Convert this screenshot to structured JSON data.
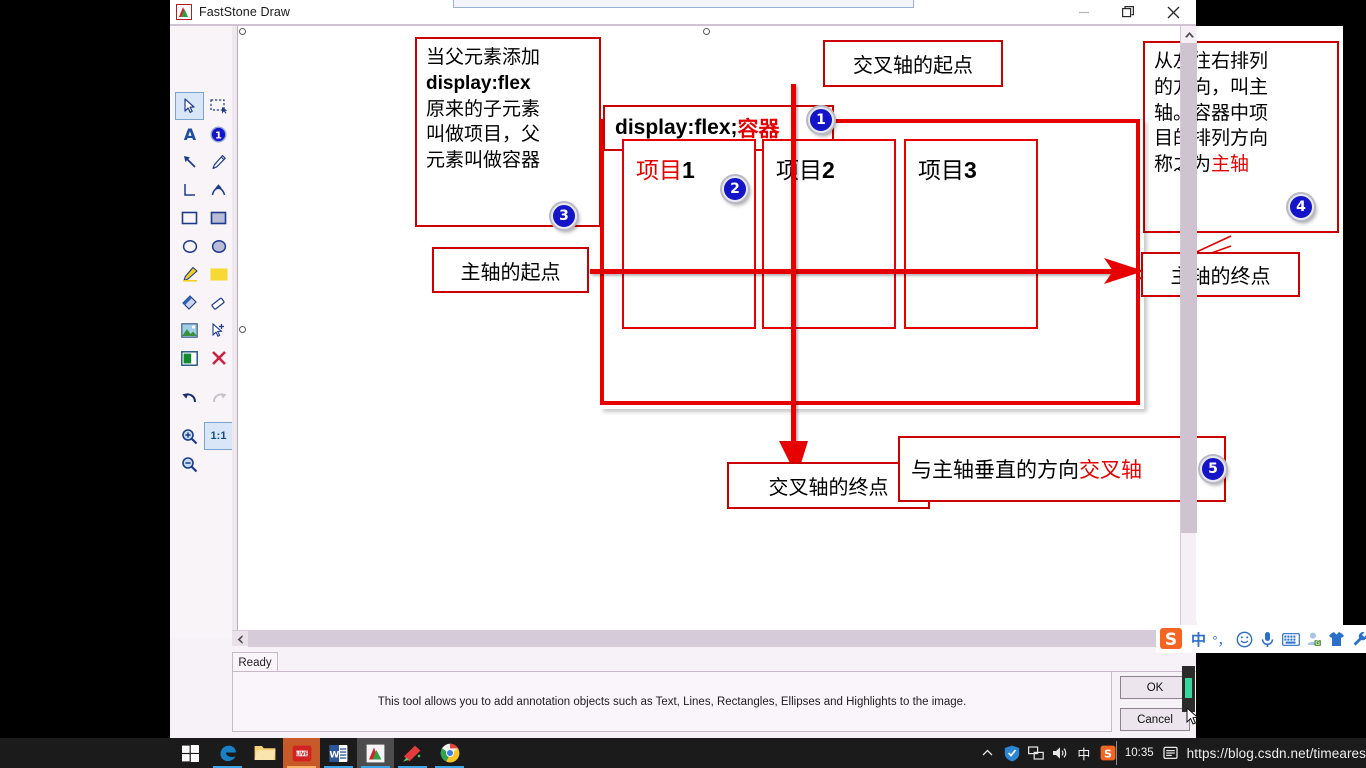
{
  "window": {
    "title": "FastStone Draw",
    "app_icon": "faststone-icon",
    "minimize_label": "—",
    "maximize_label": "❐",
    "close_label": "✕"
  },
  "toolbar": {
    "tools": [
      {
        "name": "select-arrow-tool",
        "icon": "cursor-arrow-icon",
        "selected": true
      },
      {
        "name": "marquee-select-tool",
        "icon": "dashed-rectangle-icon",
        "selected": false
      },
      {
        "name": "text-tool",
        "icon": "letter-a-icon",
        "selected": false
      },
      {
        "name": "numbered-callout-tool",
        "icon": "circled-one-icon",
        "selected": false
      },
      {
        "name": "arrow-line-tool",
        "icon": "arrow-up-left-icon",
        "selected": false
      },
      {
        "name": "pencil-tool",
        "icon": "pencil-icon",
        "selected": false
      },
      {
        "name": "corner-line-tool",
        "icon": "corner-bracket-icon",
        "selected": false
      },
      {
        "name": "curve-arrow-tool",
        "icon": "curved-arrow-icon",
        "selected": false
      },
      {
        "name": "rectangle-outline-tool",
        "icon": "rectangle-icon",
        "selected": false
      },
      {
        "name": "rectangle-filled-tool",
        "icon": "filled-rectangle-icon",
        "selected": false
      },
      {
        "name": "ellipse-outline-tool",
        "icon": "ellipse-icon",
        "selected": false
      },
      {
        "name": "ellipse-filled-tool",
        "icon": "filled-ellipse-icon",
        "selected": false
      },
      {
        "name": "highlighter-tool",
        "icon": "highlighter-pen-icon",
        "selected": false
      },
      {
        "name": "highlight-fill-tool",
        "icon": "yellow-swatch-icon",
        "selected": false
      },
      {
        "name": "blur-tool",
        "icon": "blur-icon",
        "selected": false
      },
      {
        "name": "eraser-tool",
        "icon": "eraser-icon",
        "selected": false
      },
      {
        "name": "insert-image-tool",
        "icon": "picture-icon",
        "selected": false
      },
      {
        "name": "clone-tool",
        "icon": "cursor-plus-icon",
        "selected": false
      },
      {
        "name": "color-pick-tool",
        "icon": "green-square-icon",
        "selected": false
      },
      {
        "name": "delete-object-tool",
        "icon": "red-x-icon",
        "selected": false
      }
    ],
    "undo": {
      "name": "undo-button",
      "icon": "undo-arrow-icon",
      "enabled": true
    },
    "redo": {
      "name": "redo-button",
      "icon": "redo-arrow-icon",
      "enabled": false
    },
    "zoom_in": {
      "name": "zoom-in-button",
      "icon": "magnifier-plus-icon"
    },
    "zoom_out": {
      "name": "zoom-out-button",
      "icon": "magnifier-minus-icon"
    },
    "actual_size_label": "1:1"
  },
  "diagram": {
    "container_label_prefix": "display:flex;",
    "container_label_cjk": "容器",
    "items": [
      {
        "label_cjk": "项目",
        "label_num": "1",
        "red": true
      },
      {
        "label_cjk": "项目",
        "label_num": "2",
        "red": false
      },
      {
        "label_cjk": "项目",
        "label_num": "3",
        "red": false
      }
    ],
    "badges": [
      "1",
      "2",
      "3",
      "4",
      "5"
    ],
    "note_left": {
      "lines": [
        "当父元素添加",
        "display:flex",
        "原来的子元素",
        "叫做项目，父",
        "元素叫做容器"
      ],
      "bold_line_index": 1
    },
    "note_right": {
      "lines": [
        "从左往右排列",
        "的方向，叫主",
        "轴。容器中项",
        "目的排列方向",
        "称之为"
      ],
      "highlight": "主轴"
    },
    "label_cross_start": "交叉轴的起点",
    "label_cross_end": "交叉轴的终点",
    "label_main_start": "主轴的起点",
    "label_main_end": "主轴的终点",
    "label_cross_axis_prefix": "与主轴垂直的方向",
    "label_cross_axis_highlight": "交叉轴",
    "colors": {
      "line_red": "#e60000",
      "box_red": "#cc0000",
      "badge_blue": "#1414c8",
      "text_black": "#000000"
    }
  },
  "statusbar": {
    "ready_tab": "Ready",
    "hint": "This tool allows you to add annotation objects such as Text, Lines, Rectangles, Ellipses and Highlights to the image.",
    "ok_label": "OK",
    "cancel_label": "Cancel"
  },
  "ime": {
    "icons": [
      "sogou-logo-icon",
      "chinese-mode-icon",
      "punctuation-mode-icon",
      "emoji-icon",
      "voice-input-icon",
      "soft-keyboard-icon",
      "user-account-icon",
      "skin-shirt-icon",
      "toolbox-wrench-icon"
    ],
    "chinese_mode_label": "中",
    "punctuation_label": "°，"
  },
  "taskbar": {
    "items": [
      {
        "name": "start-button",
        "icon": "windows-logo-icon"
      },
      {
        "name": "taskbar-edge",
        "icon": "edge-browser-icon"
      },
      {
        "name": "taskbar-file-explorer",
        "icon": "folder-icon"
      },
      {
        "name": "taskbar-wps-writer",
        "icon": "wps-red-icon"
      },
      {
        "name": "taskbar-word",
        "icon": "word-icon"
      },
      {
        "name": "taskbar-faststone-capture",
        "icon": "faststone-icon"
      },
      {
        "name": "taskbar-snipaste",
        "icon": "snipaste-icon"
      },
      {
        "name": "taskbar-chrome",
        "icon": "chrome-icon"
      }
    ],
    "tray": {
      "expand": "∧",
      "icons": [
        "shield-icon",
        "network-icon",
        "volume-icon",
        "ime-chinese-icon",
        "sogou-icon",
        "notification-icon"
      ],
      "ime_label": "中",
      "clock": "10:35"
    },
    "watermark": "https://blog.csdn.net/timeares"
  }
}
